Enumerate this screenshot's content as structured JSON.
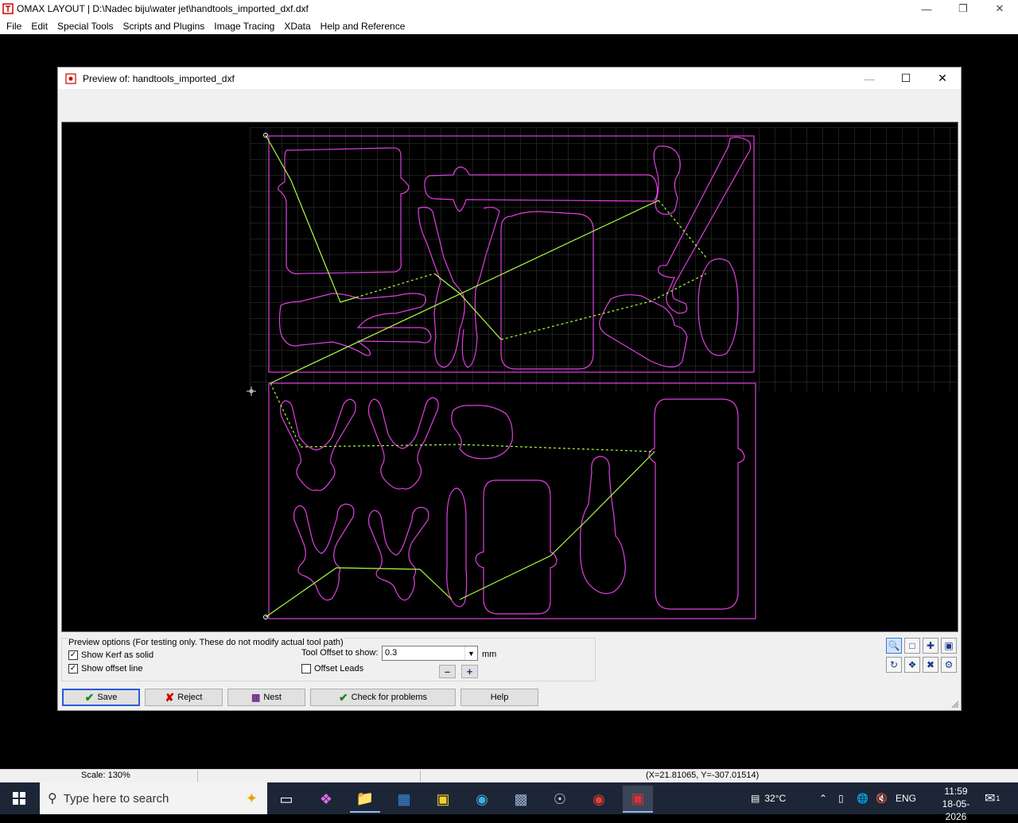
{
  "app": {
    "title": "OMAX LAYOUT | D:\\Nadec biju\\water jet\\handtools_imported_dxf.dxf",
    "menu": [
      "File",
      "Edit",
      "Special Tools",
      "Scripts and Plugins",
      "Image Tracing",
      "XData",
      "Help and Reference"
    ]
  },
  "dialog": {
    "title": "Preview of: handtools_imported_dxf"
  },
  "options": {
    "legend": "Preview options (For testing only. These do not modify actual tool path)",
    "show_kerf_label": "Show Kerf as solid",
    "show_kerf_checked": true,
    "show_offset_label": "Show offset line",
    "show_offset_checked": true,
    "tool_offset_label": "Tool Offset to show:",
    "tool_offset_value": "0.3",
    "unit": "mm",
    "offset_leads_label": "Offset Leads",
    "offset_leads_checked": false
  },
  "buttons": {
    "save": "Save",
    "reject": "Reject",
    "nest": "Nest",
    "check": "Check for problems",
    "help": "Help"
  },
  "status": {
    "scale": "Scale: 130%",
    "coords": "(X=21.81065, Y=-307.01514)"
  },
  "taskbar": {
    "search_placeholder": "Type here to search",
    "temperature": "32°C",
    "language": "ENG",
    "time": "11:59",
    "date": "18-05-2026",
    "notifications": "1"
  },
  "colors": {
    "part_outline": "#e040e0",
    "toolpath": "#a8ff40",
    "grid": "#3a3a3a"
  }
}
